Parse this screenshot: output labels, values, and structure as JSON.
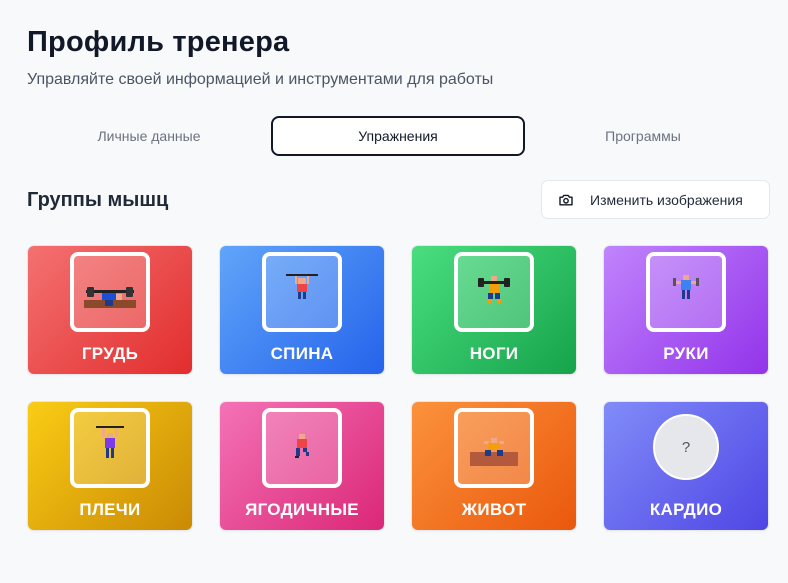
{
  "header": {
    "title": "Профиль тренера",
    "subtitle": "Управляйте своей информацией и инструментами для работы"
  },
  "tabs": [
    {
      "label": "Личные данные",
      "active": false
    },
    {
      "label": "Упражнения",
      "active": true
    },
    {
      "label": "Программы",
      "active": false
    }
  ],
  "section": {
    "title": "Группы мышц",
    "change_button_label": "Изменить изображения",
    "change_button_icon": "camera-icon"
  },
  "muscle_groups": [
    {
      "label": "ГРУДЬ",
      "color": "#ef4444",
      "icon": "bench-press-icon"
    },
    {
      "label": "СПИНА",
      "color": "#3b82f6",
      "icon": "pull-up-icon"
    },
    {
      "label": "НОГИ",
      "color": "#22c55e",
      "icon": "squat-icon"
    },
    {
      "label": "РУКИ",
      "color": "#a855f7",
      "icon": "dumbbell-curl-icon"
    },
    {
      "label": "ПЛЕЧИ",
      "color": "#eab308",
      "icon": "overhead-press-icon"
    },
    {
      "label": "ЯГОДИЧНЫЕ",
      "color": "#ec4899",
      "icon": "lunge-icon"
    },
    {
      "label": "ЖИВОТ",
      "color": "#f97316",
      "icon": "crunch-icon"
    },
    {
      "label": "КАРДИО",
      "color": "#6366f1",
      "icon": "placeholder-icon",
      "placeholder_text": "?"
    }
  ]
}
